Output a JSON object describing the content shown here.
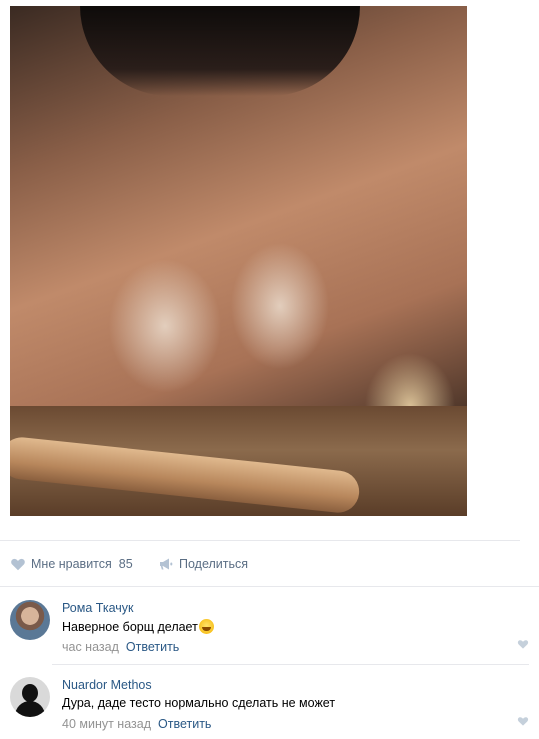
{
  "post": {
    "image_alt": "post-photo"
  },
  "actions": {
    "like_label": "Мне нравится",
    "like_count": "85",
    "share_label": "Поделиться",
    "icon_color": "#b3c2d3"
  },
  "comments": [
    {
      "author": "Рома Ткачук",
      "text": "Наверное борщ делает",
      "time": "час назад",
      "reply_label": "Ответить"
    },
    {
      "author": "Nuardor Methos",
      "text": "Дура, даде тесто нормально сделать не может",
      "time": "40 минут назад",
      "reply_label": "Ответить"
    }
  ]
}
